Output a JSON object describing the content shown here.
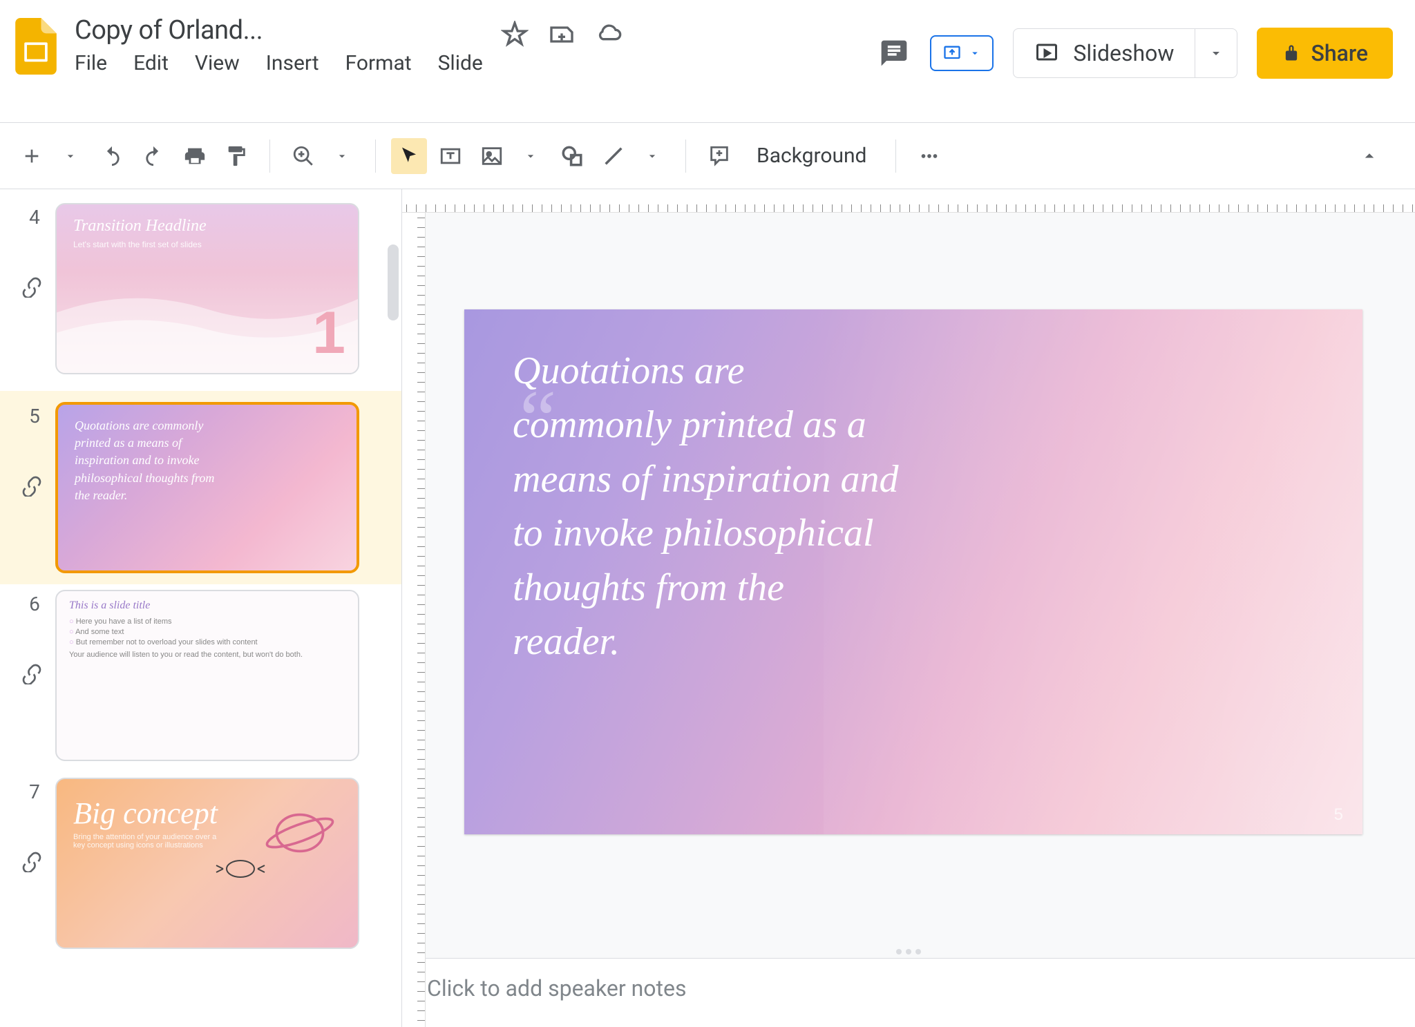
{
  "header": {
    "title": "Copy of Orland...",
    "menus": [
      "File",
      "Edit",
      "View",
      "Insert",
      "Format",
      "Slide"
    ],
    "slideshow_label": "Slideshow",
    "share_label": "Share"
  },
  "toolbar": {
    "background_label": "Background"
  },
  "filmstrip": {
    "slides": [
      {
        "num": "4",
        "title": "Transition Headline",
        "sub": "Let's start with the first set of slides",
        "big_num": "1"
      },
      {
        "num": "5",
        "quote": "Quotations are commonly printed as a means of inspiration and to invoke philosophical thoughts from the reader."
      },
      {
        "num": "6",
        "title": "This is a slide title",
        "items": [
          "Here you have a list of items",
          "And some text",
          "But remember not to overload your slides with content"
        ],
        "footer": "Your audience will listen to you or read the content, but won't do both."
      },
      {
        "num": "7",
        "title": "Big concept",
        "sub": "Bring the attention of your audience over a key concept using icons or illustrations"
      }
    ]
  },
  "canvas": {
    "slide_text": "Quotations are commonly printed as a means of inspiration and to invoke philosophical thoughts from the reader.",
    "slide_number": "5"
  },
  "notes": {
    "placeholder": "Click to add speaker notes"
  }
}
